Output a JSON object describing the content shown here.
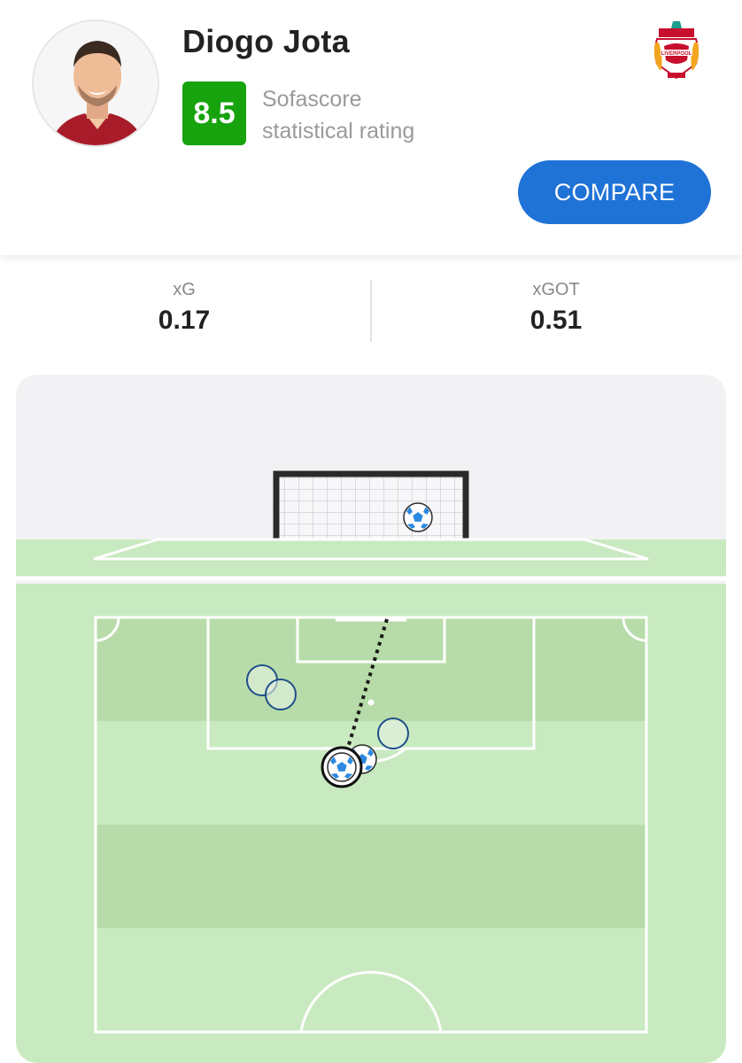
{
  "player": {
    "name": "Diogo Jota",
    "rating": "8.5",
    "rating_label_line1": "Sofascore",
    "rating_label_line2": "statistical rating",
    "rating_color": "#16a30e"
  },
  "club": {
    "logo_icon": "liverpool-crest-icon",
    "logo_text": "LIVERPOOL"
  },
  "actions": {
    "compare_label": "COMPARE",
    "accent": "#1f72d6"
  },
  "stats": [
    {
      "label": "xG",
      "value": "0.17"
    },
    {
      "label": "xGOT",
      "value": "0.51"
    }
  ],
  "pitch": {
    "background": "#c9eac0",
    "shots": [
      {
        "type": "miss",
        "selected": false
      },
      {
        "type": "miss",
        "selected": false
      },
      {
        "type": "miss",
        "selected": false
      },
      {
        "type": "goal",
        "selected": false
      },
      {
        "type": "goal",
        "selected": true
      }
    ],
    "goal_shot": {
      "type": "goal"
    }
  }
}
